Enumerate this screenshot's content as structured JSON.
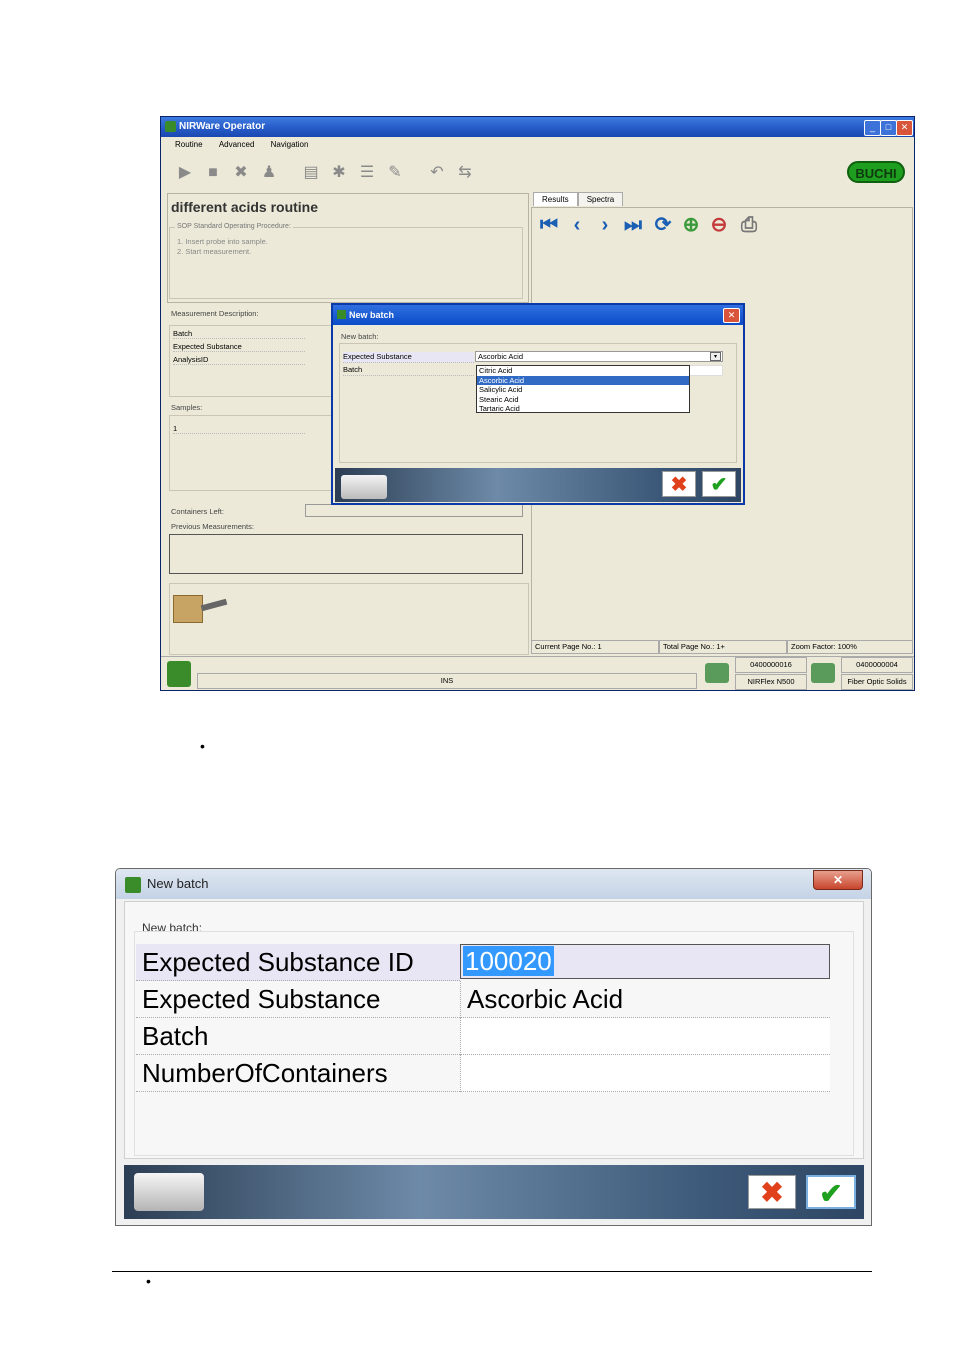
{
  "main_window": {
    "title": "NIRWare Operator",
    "menu": [
      "Routine",
      "Advanced",
      "Navigation"
    ],
    "logo": "BUCHI",
    "routine_title": "different acids routine",
    "sop_label": "SOP Standard Operating Procedure:",
    "sop_lines": [
      "1. Insert probe into sample.",
      "2. Start measurement."
    ],
    "measurement_description_label": "Measurement Description:",
    "measurement_rows": [
      "Batch",
      "Expected Substance",
      "AnalysisID"
    ],
    "samples_label": "Samples:",
    "samples_value": "1",
    "containers_left_label": "Containers Left:",
    "previous_measurements_label": "Previous Measurements:",
    "tabs": [
      "Results",
      "Spectra"
    ],
    "status": {
      "current_page": "Current Page No.: 1",
      "total_page": "Total Page No.: 1+",
      "zoom": "Zoom Factor: 100%"
    },
    "bottom": {
      "ins": "INS",
      "device_id_1": "0400000016",
      "device_name_1": "NIRFlex N500",
      "device_id_2": "0400000004",
      "device_name_2": "Fiber Optic Solids"
    }
  },
  "small_dialog": {
    "title": "New batch",
    "group_label": "New batch:",
    "rows": [
      {
        "label": "Expected Substance",
        "value": "Ascorbic Acid"
      },
      {
        "label": "Batch",
        "value": ""
      }
    ],
    "dropdown_options": [
      "Citric Acid",
      "Ascorbic Acid",
      "Salicylic Acid",
      "Stearic Acid",
      "Tartaric Acid"
    ],
    "selected_option": "Ascorbic Acid"
  },
  "large_dialog": {
    "title": "New batch",
    "group_label": "New batch:",
    "rows": [
      {
        "label": "Expected Substance ID",
        "value": "100020"
      },
      {
        "label": "Expected Substance",
        "value": "Ascorbic Acid"
      },
      {
        "label": "Batch",
        "value": ""
      },
      {
        "label": "NumberOfContainers",
        "value": ""
      }
    ]
  },
  "bullets": [
    "•",
    "•"
  ]
}
